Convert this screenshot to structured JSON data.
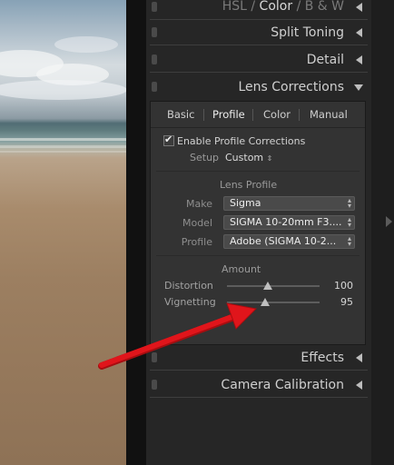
{
  "panels": {
    "hsl_header": {
      "hsl": "HSL",
      "sep1": "/",
      "color": "Color",
      "sep2": "/",
      "bw": "B & W"
    },
    "split_toning": "Split Toning",
    "detail": "Detail",
    "lens_corrections": "Lens Corrections",
    "effects": "Effects",
    "camera_calibration": "Camera Calibration"
  },
  "lens": {
    "tabs": [
      "Basic",
      "Profile",
      "Color",
      "Manual"
    ],
    "selected_tab": "Profile",
    "enable_label": "Enable Profile Corrections",
    "enable_checked": true,
    "setup_label": "Setup",
    "setup_value": "Custom",
    "profile_section": "Lens Profile",
    "make_label": "Make",
    "make_value": "Sigma",
    "model_label": "Model",
    "model_value": "SIGMA 10-20mm F3....",
    "profile_label": "Profile",
    "profile_value": "Adobe (SIGMA 10-2...",
    "amount_label": "Amount",
    "distortion_label": "Distortion",
    "distortion_value": "100",
    "vignetting_label": "Vignetting",
    "vignetting_value": "95"
  },
  "colors": {
    "panel_bg": "#262626",
    "section_bg": "#333333",
    "arrow_red": "#e0151b"
  }
}
